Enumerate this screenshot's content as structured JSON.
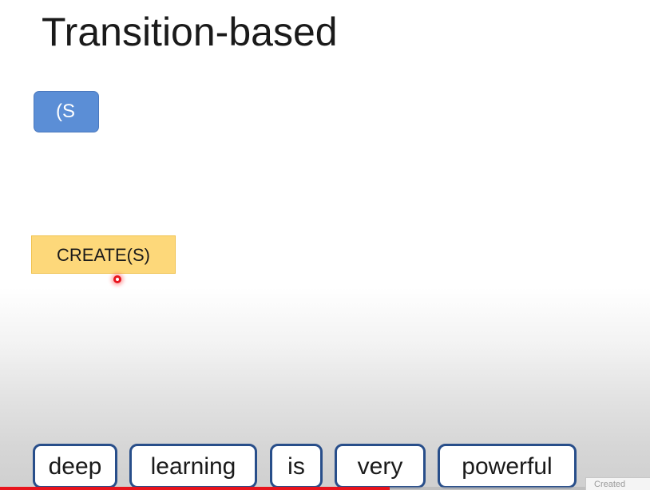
{
  "slide": {
    "title": "Transition-based",
    "stack_node": "(S",
    "action": "CREATE(S)"
  },
  "buffer": {
    "tokens": [
      "deep",
      "learning",
      "is",
      "very",
      "powerful"
    ]
  },
  "video": {
    "progress_fraction": 0.6,
    "corner_label": "Created"
  },
  "colors": {
    "title_text": "#1a1a1a",
    "stack_node_fill": "#5b8ed6",
    "action_fill": "#fdd87a",
    "token_border": "#284e8a",
    "cursor": "#e8141d",
    "progress": "#e8141d"
  }
}
